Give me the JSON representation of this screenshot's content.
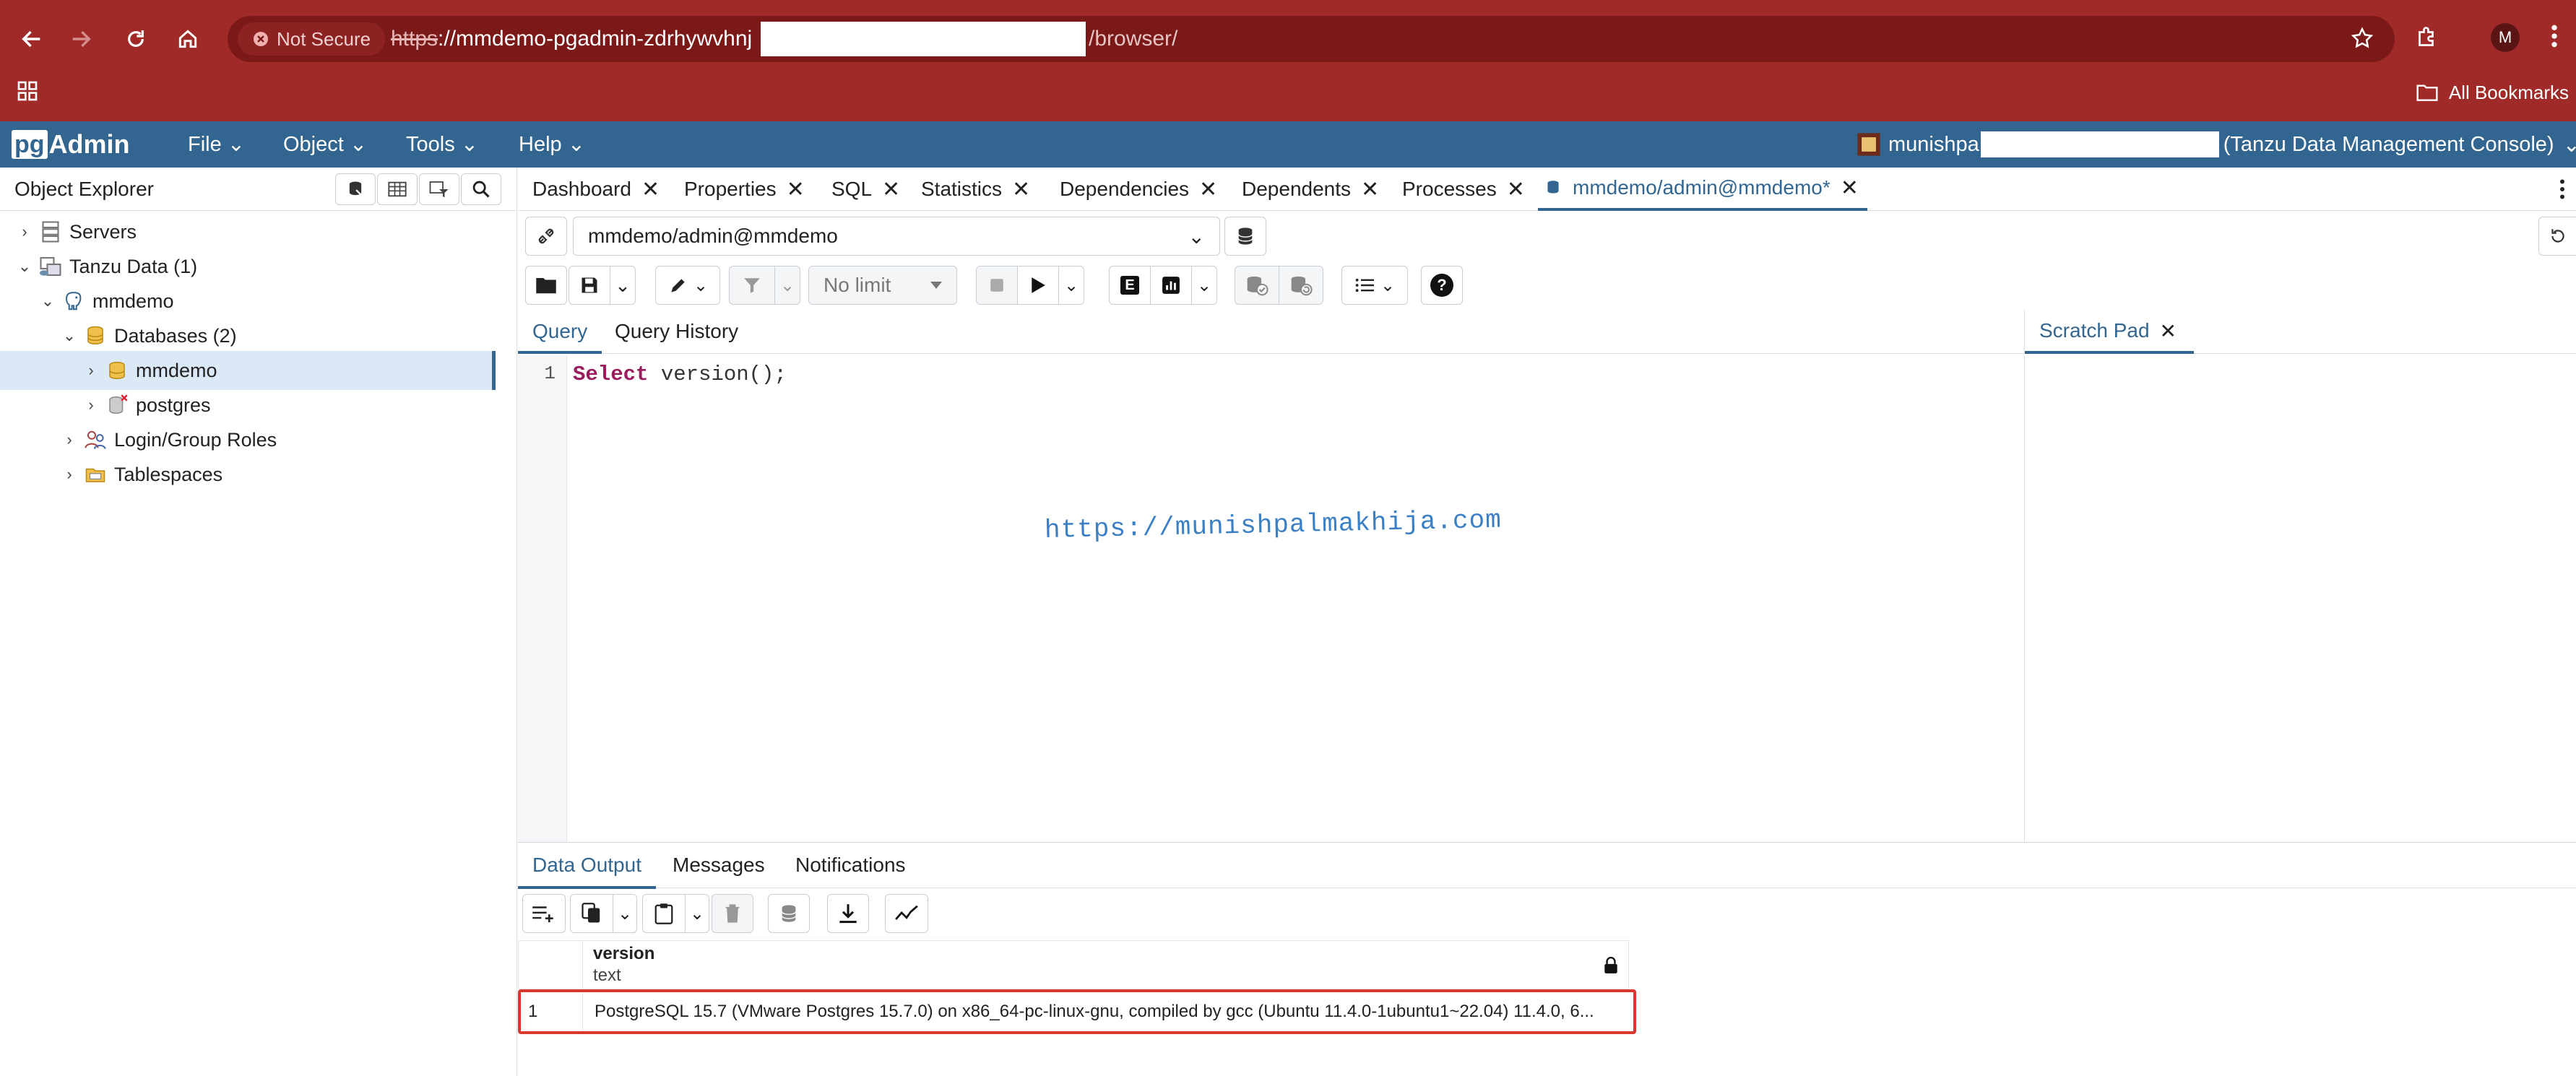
{
  "browser": {
    "security_label": "Not Secure",
    "url_protocol": "https",
    "url_host": "://mmdemo-pgadmin-zdrhywvhnj",
    "url_path": "/browser/",
    "profile_initial": "M",
    "bookmarks_label": "All Bookmarks"
  },
  "app": {
    "logo_text": "pgAdmin",
    "menus": [
      "File",
      "Object",
      "Tools",
      "Help"
    ],
    "user": {
      "name_prefix": "munishpa",
      "console_label": "(Tanzu Data Management Console)"
    }
  },
  "object_explorer": {
    "title": "Object Explorer",
    "tree": [
      {
        "label": "Servers"
      },
      {
        "label": "Tanzu Data (1)"
      },
      {
        "label": "mmdemo"
      },
      {
        "label": "Databases (2)"
      },
      {
        "label": "mmdemo",
        "selected": true
      },
      {
        "label": "postgres"
      },
      {
        "label": "Login/Group Roles"
      },
      {
        "label": "Tablespaces"
      }
    ]
  },
  "tabs": [
    "Dashboard",
    "Properties",
    "SQL",
    "Statistics",
    "Dependencies",
    "Dependents",
    "Processes",
    "mmdemo/admin@mmdemo*"
  ],
  "query_tool": {
    "connection": "mmdemo/admin@mmdemo",
    "limit": "No limit",
    "explain_label": "E",
    "help_label": "?",
    "query_tabs": [
      "Query",
      "Query History"
    ],
    "scratch_pad": "Scratch Pad",
    "line_number": "1",
    "code": {
      "keyword": "Select",
      "func": "version",
      "rest": "();"
    },
    "watermark": "https://munishpalmakhija.com"
  },
  "output": {
    "tabs": [
      "Data Output",
      "Messages",
      "Notifications"
    ],
    "column": {
      "name": "version",
      "type": "text"
    },
    "rows": [
      {
        "num": "1",
        "value": "PostgreSQL 15.7 (VMware Postgres 15.7.0) on x86_64-pc-linux-gnu, compiled by gcc (Ubuntu 11.4.0-1ubuntu1~22.04) 11.4.0, 6..."
      }
    ]
  },
  "colors": {
    "chrome": "#a02a28",
    "nav": "#326690",
    "accent": "#326690",
    "highlight": "#d8382e"
  }
}
